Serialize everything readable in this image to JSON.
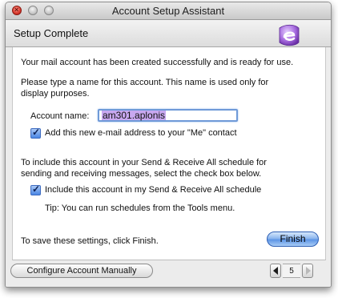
{
  "window": {
    "title": "Account Setup Assistant"
  },
  "header": {
    "title": "Setup Complete",
    "logo_icon": "entourage-logo-icon"
  },
  "content": {
    "success_message": "Your mail account has been created successfully and is ready for use.",
    "name_prompt_line1": "Please type a name for this account. This name is used only for",
    "name_prompt_line2": "display purposes.",
    "account_name_label": "Account name:",
    "account_name_value": "am301.aplonis",
    "add_to_me_checked": true,
    "add_to_me_label": "Add this new e-mail address to your \"Me\" contact",
    "schedule_info_line1": "To include this account in your Send & Receive All schedule for",
    "schedule_info_line2": "sending and receiving messages, select the check box below.",
    "include_schedule_checked": true,
    "include_schedule_label": "Include this account in my Send & Receive All schedule",
    "tip": "Tip: You can run schedules from the Tools menu.",
    "save_instruction": "To save these settings, click Finish.",
    "finish_label": "Finish"
  },
  "footer": {
    "configure_label": "Configure Account Manually",
    "page_number": "5"
  },
  "colors": {
    "accent_blue": "#5d95e6",
    "selection_purple": "#c8a8f0",
    "close_red": "#d8382c"
  }
}
